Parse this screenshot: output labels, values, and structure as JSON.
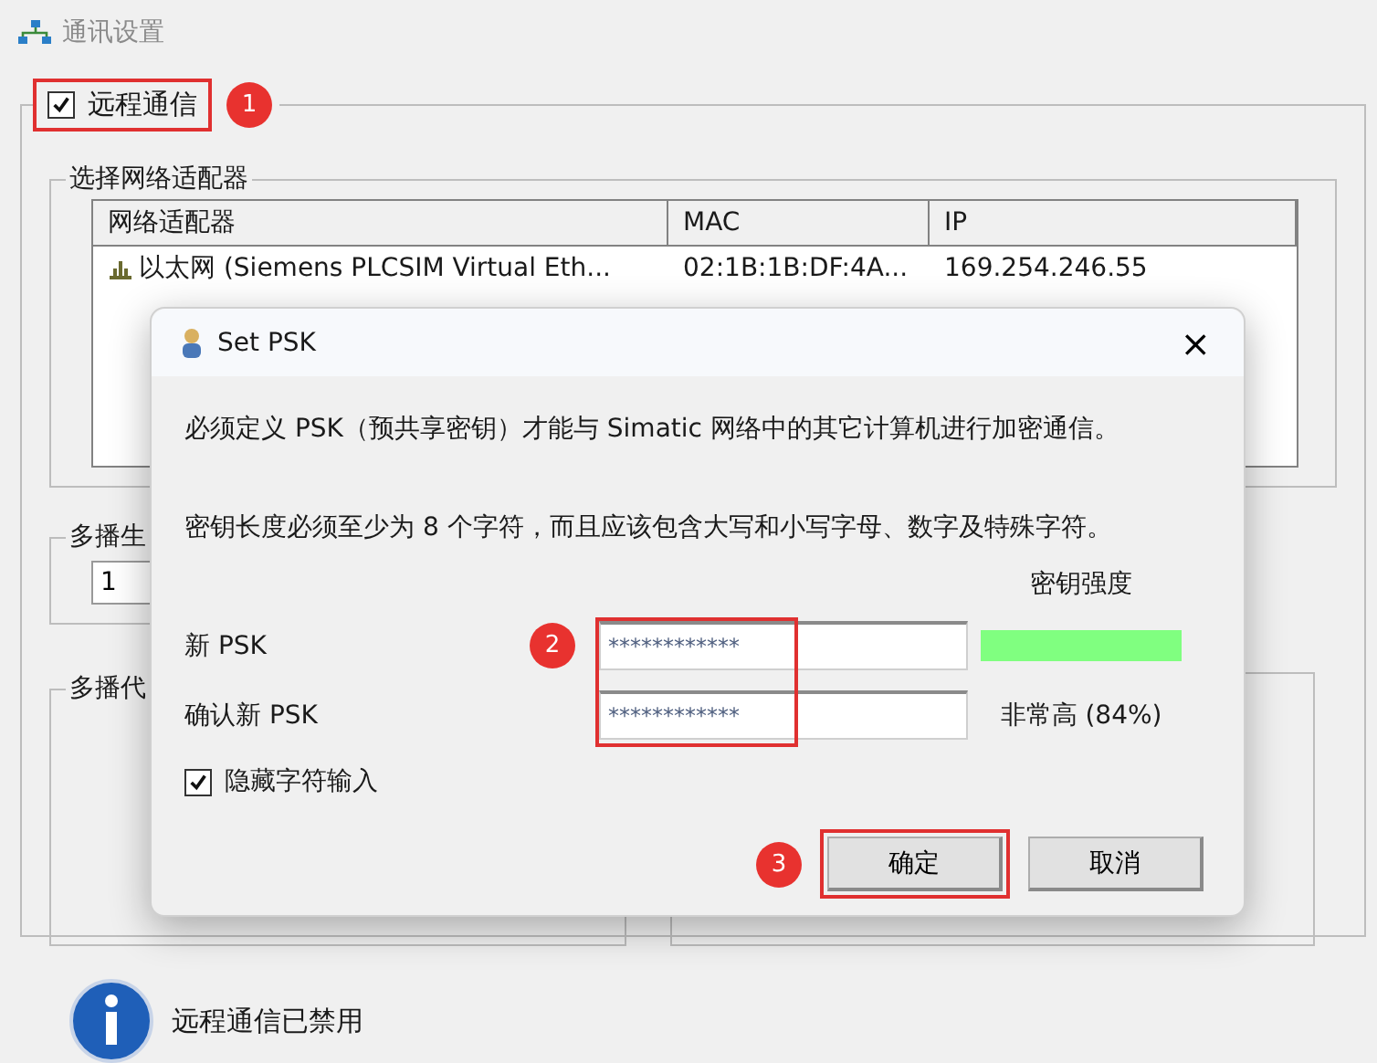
{
  "window": {
    "title": "通讯设置"
  },
  "remote": {
    "label": "远程通信",
    "checked": true,
    "highlighted": true,
    "badge": "1"
  },
  "adapter_group": {
    "title": "选择网络适配器",
    "columns": [
      "网络适配器",
      "MAC",
      "IP"
    ],
    "rows": [
      {
        "cells": [
          "以太网 (Siemens PLCSIM Virtual Eth...",
          "02:1B:1B:DF:4A...",
          "169.254.246.55"
        ]
      }
    ]
  },
  "multicast_group_1": {
    "title": "多播生",
    "value": "1"
  },
  "multicast_group_2": {
    "title": "多播代"
  },
  "status": {
    "text": "远程通信已禁用"
  },
  "dialog": {
    "title": "Set PSK",
    "close": "×",
    "intro": "必须定义 PSK（预共享密钥）才能与 Simatic 网络中的其它计算机进行加密通信。",
    "requirement": "密钥长度必须至少为 8 个字符，而且应该包含大写和小写字母、数字及特殊字符。",
    "strength_label": "密钥强度",
    "fields": [
      {
        "label": "新 PSK",
        "value": "************"
      },
      {
        "label": "确认新 PSK",
        "value": "************"
      }
    ],
    "fields_highlighted": true,
    "fields_badge": "2",
    "strength": {
      "level": 1,
      "reading": "非常高 (84%)"
    },
    "hide_input": {
      "label": "隐藏字符输入",
      "checked": true
    },
    "buttons": [
      {
        "label": "确定",
        "highlighted": true,
        "badge": "3"
      },
      {
        "label": "取消",
        "highlighted": false
      }
    ]
  }
}
